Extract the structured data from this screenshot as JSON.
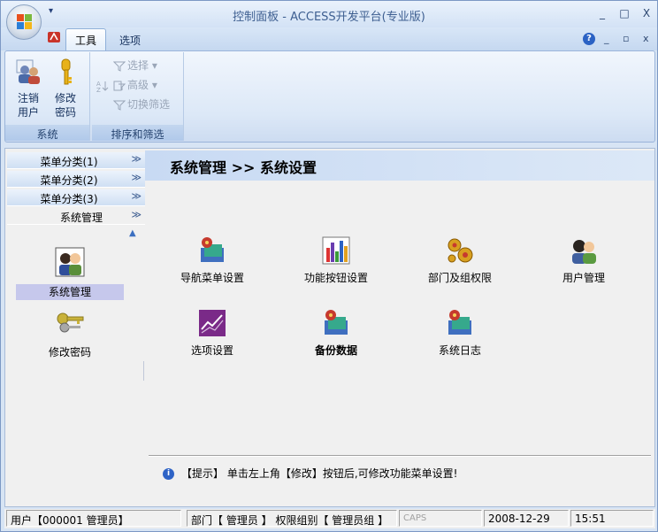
{
  "window": {
    "title": "控制面板 - ACCESS开发平台(专业版)",
    "minimize": "_",
    "maximize": "□",
    "close": "X"
  },
  "qat": {
    "dropdown": "▾"
  },
  "tabs": [
    {
      "label": "工具",
      "active": true
    },
    {
      "label": "选项",
      "active": false
    }
  ],
  "ribbon_controls": {
    "help": "?",
    "min": "_",
    "restore": "▫",
    "close": "x"
  },
  "ribbon": {
    "groups": [
      {
        "label": "系统",
        "buttons": [
          {
            "label_line1": "注销",
            "label_line2": "用户",
            "icon": "users-icon"
          },
          {
            "label_line1": "修改",
            "label_line2": "密码",
            "icon": "key-icon"
          }
        ]
      },
      {
        "label": "排序和筛选",
        "buttons": [
          {
            "label": "选择",
            "icon": "filter-select-icon",
            "has_dropdown": true
          },
          {
            "label": "高级",
            "icon": "filter-advanced-icon",
            "has_dropdown": true
          },
          {
            "label": "切换筛选",
            "icon": "filter-toggle-icon",
            "has_dropdown": false
          }
        ]
      }
    ]
  },
  "sidebar": {
    "categories": [
      {
        "label": "菜单分类(1)",
        "active": false
      },
      {
        "label": "菜单分类(2)",
        "active": false
      },
      {
        "label": "菜单分类(3)",
        "active": false
      },
      {
        "label": "系统管理",
        "active": true
      }
    ],
    "chevron": "≫",
    "up_arrow": "▲",
    "items": [
      {
        "label": "系统管理",
        "icon": "user-admin-icon",
        "selected": true
      },
      {
        "label": "修改密码",
        "icon": "keys-icon",
        "selected": false
      }
    ]
  },
  "main": {
    "heading": "系统管理 >> 系统设置",
    "functions": [
      {
        "label": "导航菜单设置",
        "icon": "database-icon",
        "bold": false
      },
      {
        "label": "功能按钮设置",
        "icon": "bar-chart-icon",
        "bold": false
      },
      {
        "label": "部门及组权限",
        "icon": "gears-icon",
        "bold": false
      },
      {
        "label": "用户管理",
        "icon": "users-icon",
        "bold": false
      },
      {
        "label": "选项设置",
        "icon": "trend-chart-icon",
        "bold": false
      },
      {
        "label": "备份数据",
        "icon": "database-icon",
        "bold": true
      },
      {
        "label": "系统日志",
        "icon": "database-icon",
        "bold": false
      }
    ],
    "hint": {
      "info_glyph": "i",
      "text": "【提示】 单击左上角【修改】按钮后,可修改功能菜单设置!"
    }
  },
  "statusbar": {
    "user": "用户【000001 管理员】",
    "dept": "部门【 管理员 】 权限组别【 管理员组 】",
    "caps": "CAPS",
    "date": "2008-12-29",
    "time": "15:51"
  },
  "colors": {
    "accent": "#2b62c4",
    "header_band": "#c8daf3",
    "selected_item": "#c6c8ec"
  }
}
